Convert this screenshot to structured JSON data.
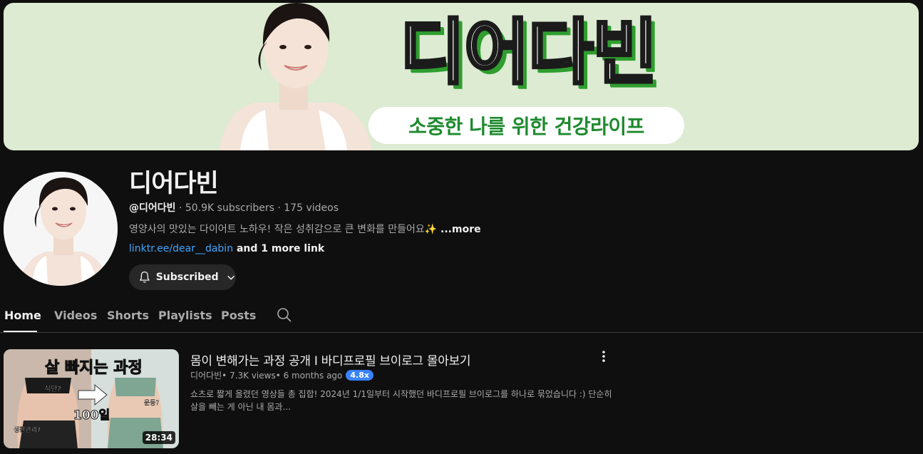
{
  "banner": {
    "title": "디어다빈",
    "tagline": "소중한 나를 위한 건강라이프"
  },
  "channel": {
    "name": "디어다빈",
    "handle": "@디어다빈",
    "stats": " · 50.9K subscribers · 175 videos",
    "description": "영양사의 맛있는 다이어트 노하우! 작은 성취감으로 큰 변화를 만들어요✨",
    "more_label": " ...more",
    "link": "linktr.ee/dear__dabin",
    "extra_links": " and 1 more link",
    "subscribe_label": "Subscribed"
  },
  "tabs": [
    {
      "label": "Home",
      "active": true
    },
    {
      "label": "Videos"
    },
    {
      "label": "Shorts"
    },
    {
      "label": "Playlists"
    },
    {
      "label": "Posts"
    }
  ],
  "video": {
    "title": "몸이 변해가는 과정 공개 I 바디프로필 브이로그 몰아보기",
    "channel": "디어다빈",
    "views": " • 7.3K views",
    "age": " • 6 months ago",
    "badge": "4.8x",
    "description": "쇼츠로 짧게 올렸던 영상들 총 집합! 2024년 1/1일부터 시작했던 바디프로필 브이로그를 하나로 묶었습니다 :) 단순히 살을 빼는 게 아닌 내 몸과...",
    "duration": "28:34",
    "thumb": {
      "headline": "살 빠지는 과정",
      "label_diet": "식단?",
      "label_days": "100일",
      "label_exercise": "운동?",
      "label_care": "생활관리?"
    }
  },
  "colors": {
    "background": "#0f0f0f",
    "banner_bg": "#dcebd2",
    "accent_green": "#2f9e2f",
    "link_blue": "#3ea6ff",
    "badge_blue": "#3a82f7"
  }
}
